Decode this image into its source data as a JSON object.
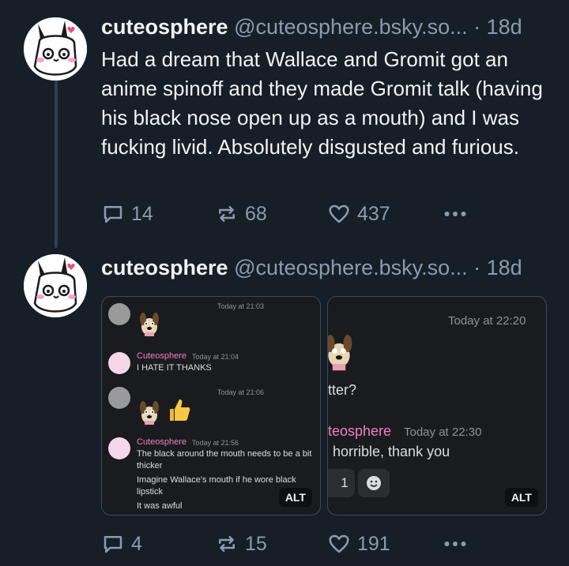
{
  "post1": {
    "name": "cuteosphere",
    "handle": "@cuteosphere.bsky.so...",
    "time": "· 18d",
    "text": "Had a dream that Wallace and Gromit got an anime spinoff and they made Gromit talk (having his black nose open up as a mouth) and I was fucking livid. Absolutely disgusted and furious.",
    "replies": "14",
    "reposts": "68",
    "likes": "437"
  },
  "post2": {
    "name": "cuteosphere",
    "handle": "@cuteosphere.bsky.so...",
    "time": "· 18d",
    "replies": "4",
    "reposts": "15",
    "likes": "191",
    "images": [
      {
        "alt_label": "ALT",
        "ts1": "Today at 21:03",
        "user": "Cuteosphere",
        "ts2": "Today at 21:04",
        "msg1": "I HATE IT THANKS",
        "ts3": "Today at 21:06",
        "ts4": "Today at 21:56",
        "msg2": "The black around the mouth needs to be a bit thicker",
        "msg3": "Imagine Wallace's mouth if he wore black lipstick",
        "msg4": "It was awful"
      },
      {
        "alt_label": "ALT",
        "ts1": "Today at 22:20",
        "fragment": "tter?",
        "user": "teosphere",
        "ts2": "Today at 22:30",
        "msg1": "horrible, thank you",
        "reaction_count": "1"
      }
    ]
  },
  "colors": {
    "background": "#161e27",
    "muted": "#8b9bb0",
    "thread_line": "#2e4052",
    "discord_pink": "#f47fbe"
  },
  "icons": [
    "reply-icon",
    "repost-icon",
    "like-icon",
    "more-icon"
  ]
}
